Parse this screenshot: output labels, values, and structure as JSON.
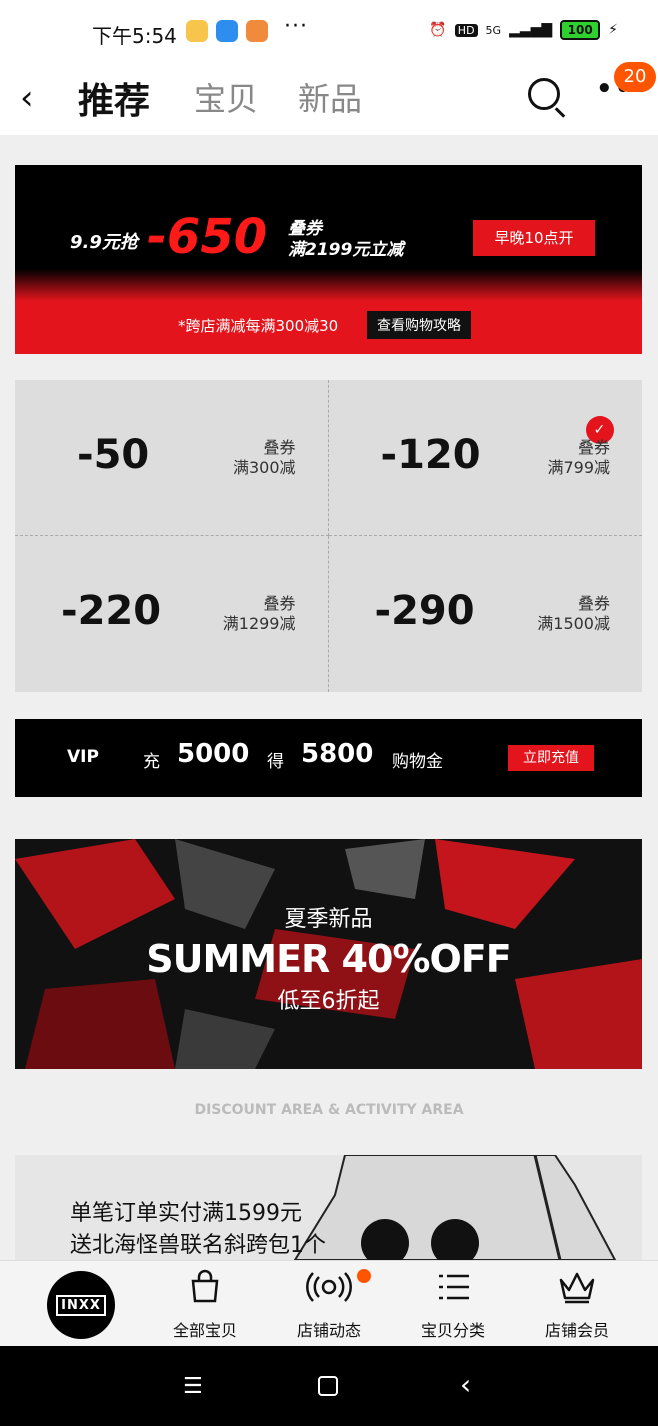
{
  "status_bar": {
    "time": "下午5:54",
    "dots": "···",
    "hd": "HD",
    "signal": "5G",
    "battery": "100"
  },
  "nav": {
    "back_icon": "back-arrow-icon",
    "tabs": [
      {
        "label": "推荐"
      },
      {
        "label": "宝贝"
      },
      {
        "label": "新品"
      }
    ],
    "badge": "20"
  },
  "banner": {
    "left": "9.9元抢",
    "amount": "-650",
    "stack_1": "叠券",
    "stack_2": "满2199元立减",
    "button": "早晚10点开",
    "note": "*跨店满减每满300减30",
    "link": "查看购物攻略"
  },
  "coupons": [
    {
      "amount": "-50",
      "line_1": "叠券",
      "line_2": "满300减"
    },
    {
      "amount": "-120",
      "line_1": "叠券",
      "line_2": "满799减"
    },
    {
      "amount": "-220",
      "line_1": "叠券",
      "line_2": "满1299减"
    },
    {
      "amount": "-290",
      "line_1": "叠券",
      "line_2": "满1500减"
    }
  ],
  "vip": {
    "label": "VIP",
    "charge": "充",
    "charge_amount": "5000",
    "get": "得",
    "get_amount": "5800",
    "suffix": "购物金",
    "button": "立即充值"
  },
  "summer": {
    "title": "夏季新品",
    "headline": "SUMMER 40%OFF",
    "sub": "低至6折起"
  },
  "divider_text": "DISCOUNT AREA & ACTIVITY AREA",
  "promo": {
    "line_1": "单笔订单实付满1599元",
    "line_2": "送北海怪兽联名斜跨包1个"
  },
  "bottom_bar": {
    "logo": "INXX",
    "items": [
      {
        "label": "全部宝贝"
      },
      {
        "label": "店铺动态"
      },
      {
        "label": "宝贝分类"
      },
      {
        "label": "店铺会员"
      }
    ]
  },
  "colors": {
    "accent": "#e3141c",
    "badge": "#ff5500"
  }
}
